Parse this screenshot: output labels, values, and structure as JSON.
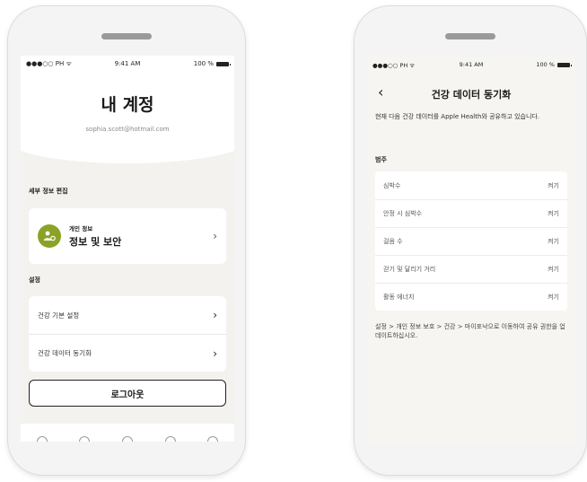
{
  "account_screen": {
    "status": {
      "carrier": "●●●○○ PH ᯤ",
      "time": "9:41 AM",
      "battery": "100 %"
    },
    "title": "내 계정",
    "email": "sophia.scott@hotmail.com",
    "edit_section_label": "세부 정보 편집",
    "profile_card": {
      "subtitle": "개인 정보",
      "title": "정보 및 보안"
    },
    "settings_section_label": "설정",
    "settings_items": [
      {
        "label": "건강 기본 설정"
      },
      {
        "label": "건강 데이터 동기화"
      }
    ],
    "logout_label": "로그아웃"
  },
  "sync_screen": {
    "status": {
      "carrier": "●●●○○ PH ᯤ",
      "time": "9:41 AM",
      "battery": "100 %"
    },
    "title": "건강 데이터 동기화",
    "description": "현재 다음 건강 데이터를 Apple Health와 공유하고 있습니다.",
    "category_label": "범주",
    "categories": [
      {
        "label": "심박수",
        "value": "켜기"
      },
      {
        "label": "안정 시 심박수",
        "value": "켜기"
      },
      {
        "label": "걸음 수",
        "value": "켜기"
      },
      {
        "label": "걷기 및 달리기 거리",
        "value": "켜기"
      },
      {
        "label": "활동 에너지",
        "value": "켜기"
      }
    ],
    "footer_note": "설정 > 개인 정보 보호 > 건강 > 마이포낙으로 이동하여 공유 권한을 업데이트하십시오."
  },
  "colors": {
    "accent": "#8aa327",
    "background": "#f3f2ef"
  }
}
